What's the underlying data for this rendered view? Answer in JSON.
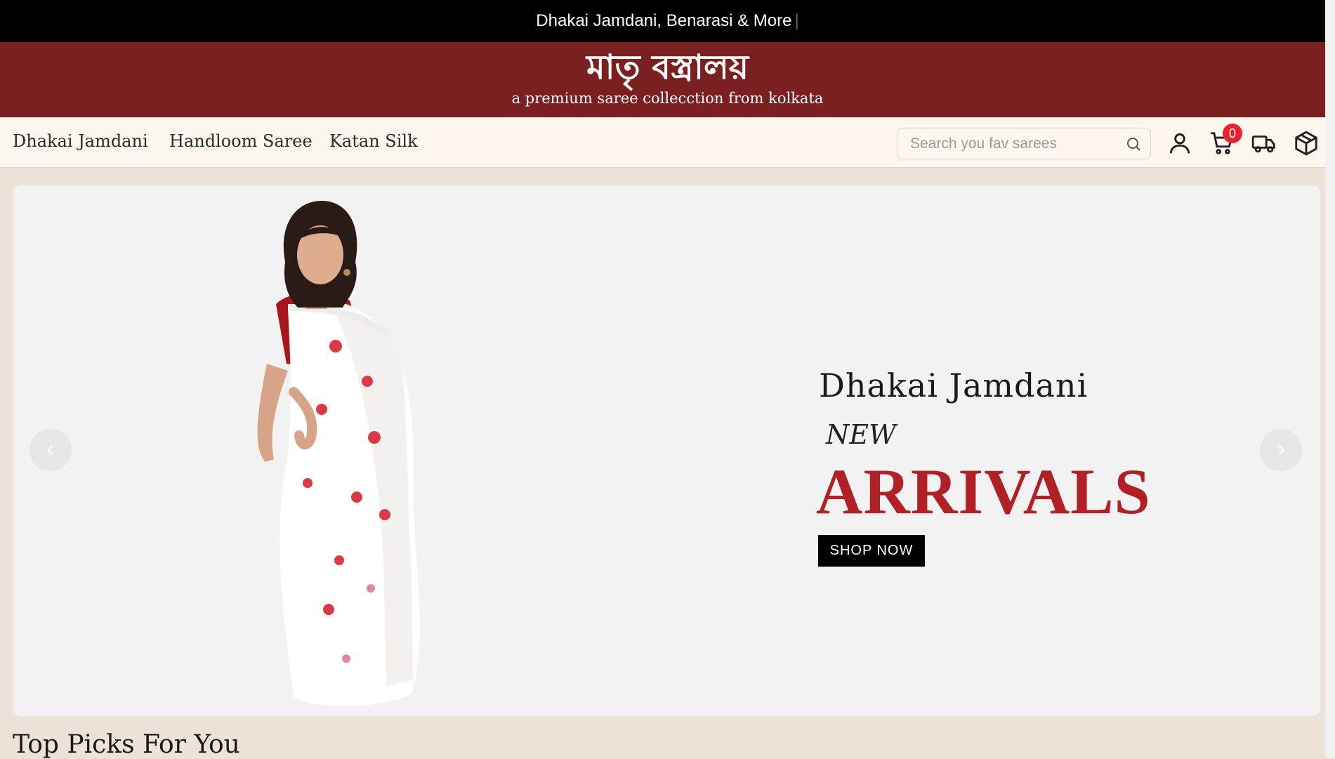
{
  "announcement": {
    "text": "Dhakai Jamdani, Benarasi & More",
    "caret": "|"
  },
  "brand": {
    "logo_text": "মাতৃ বস্ত্রালয়",
    "tagline": "a premium saree collecction from kolkata"
  },
  "nav": {
    "links": [
      "Dhakai Jamdani",
      "Handloom Saree",
      "Katan Silk"
    ]
  },
  "search": {
    "placeholder": "Search you fav sarees",
    "value": ""
  },
  "header_icons": [
    "user-icon",
    "cart-icon",
    "truck-icon",
    "box-icon"
  ],
  "cart": {
    "count": "0"
  },
  "hero": {
    "subtitle": "Dhakai Jamdani",
    "kicker": "NEW",
    "headline": "ARRIVALS",
    "cta_label": "SHOP NOW",
    "prev_icon": "chevron-left-icon",
    "next_icon": "chevron-right-icon"
  },
  "sections": {
    "top_picks_title": "Top Picks For You"
  },
  "colors": {
    "announcement_bg": "#000000",
    "brand_bg": "#7b1f20",
    "nav_bg": "#fdf6ee",
    "page_bg": "#ede2d8",
    "hero_bg": "#f2f2f2",
    "accent_red": "#b02025",
    "badge_red": "#e8232f"
  }
}
